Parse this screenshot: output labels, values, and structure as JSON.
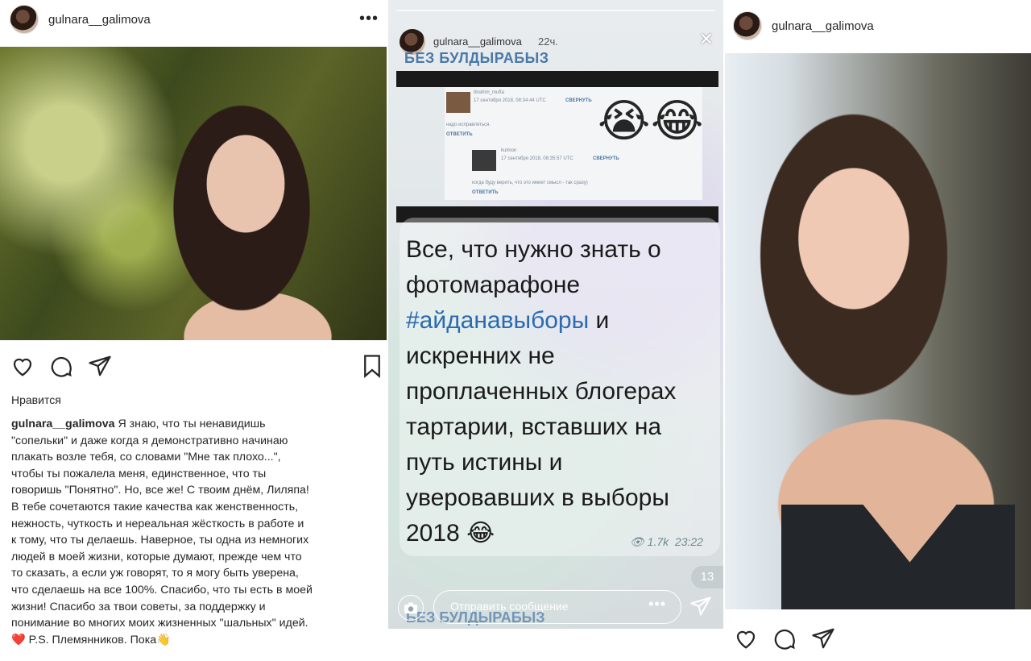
{
  "left_post": {
    "username": "gulnara__galimova",
    "more_icon": "•••",
    "likes_label": "Нравится",
    "caption_user": "gulnara__galimova",
    "caption_lines": [
      " Я знаю, что ты ненавидишь",
      "\"сопельки\" и даже когда я демонстративно начинаю",
      "плакать возле тебя, со словами \"Мне так плохо...\",",
      "чтобы ты пожалела меня, единственное, что ты",
      "говоришь \"Понятно\". Но, все же! С твоим днём, Лиляпа!",
      "В тебе сочетаются такие качества  как женственность,",
      "нежность, чуткость  и нереальная жёсткость в работе и",
      "к тому, что ты делаешь. Наверное, ты одна из немногих",
      "людей в моей жизни, которые думают, прежде чем что",
      "то сказать, а если уж говорят, то я могу быть уверена,",
      "что сделаешь на все 100%. Спасибо, что ты есть в моей",
      "жизни! Спасибо за твои советы, за поддержку и",
      "понимание во многих моих жизненных \"шальных\" идей."
    ],
    "heart_emoji": "❤️",
    "ps_line": " P.S. Племянников. Пока",
    "wave_emoji": "👋"
  },
  "story": {
    "username": "gulnara__galimova",
    "time": "22ч.",
    "close_icon": "✕",
    "channel_name": "БЕЗ БУЛДЫРАБЫЗ",
    "comments": [
      {
        "author": "ibrahim_mufta",
        "date": "17 сентября 2018, 08:34:44 UTC",
        "action": "СВЕРНУТЬ",
        "text": "надо исправляться.",
        "reply": "ОТВЕТИТЬ"
      },
      {
        "author": "kulmon",
        "date": "17 сентября 2018, 08:35:57 UTC",
        "action": "СВЕРНУТЬ",
        "text": "когда буду верить, что это имеет смысл - так сразу)",
        "reply": "ОТВЕТИТЬ"
      }
    ],
    "emoji_cry": "😭",
    "emoji_laugh": "😂",
    "text_before": "Все, что нужно знать о фотомарафоне ",
    "hashtag": "#айданавыборы",
    "text_after": " и искренних не проплаченных блогерах тартарии, вставших на путь истины и уверовавших в выборы 2018 ",
    "text_emoji": "😂",
    "views": "1.7k",
    "msg_time": "23:22",
    "unread_badge": "13",
    "message_placeholder": "Отправить сообщение",
    "message_more": "•••"
  },
  "right_post": {
    "username": "gulnara__galimova"
  }
}
